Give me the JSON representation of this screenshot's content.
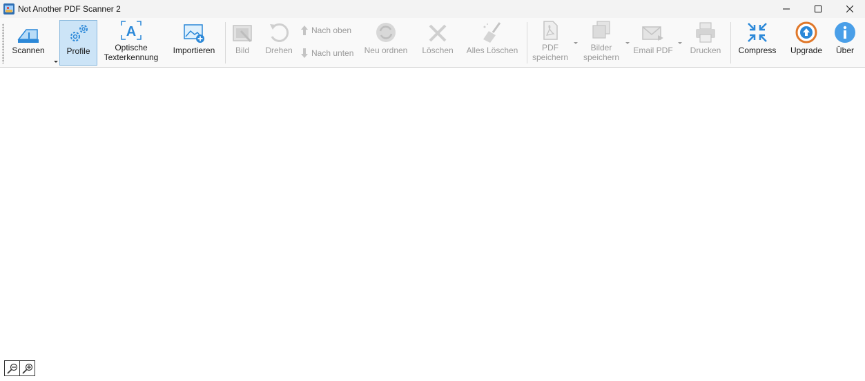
{
  "window": {
    "title": "Not Another PDF Scanner 2",
    "controls": [
      "minimize",
      "maximize",
      "close"
    ]
  },
  "toolbar": {
    "scan": "Scannen",
    "profile": "Profile",
    "ocr": "Optische\nTexterkennung",
    "import": "Importieren",
    "image": "Bild",
    "rotate": "Drehen",
    "move_up": "Nach oben",
    "move_down": "Nach unten",
    "reorder": "Neu ordnen",
    "delete": "Löschen",
    "delete_all": "Alles Löschen",
    "save_pdf": "PDF\nspeichern",
    "save_images": "Bilder\nspeichern",
    "email_pdf": "Email PDF",
    "print": "Drucken",
    "compress": "Compress",
    "upgrade": "Upgrade",
    "about": "Über"
  },
  "colors": {
    "accent": "#2b88d8",
    "active_bg": "#cce4f7",
    "disabled_text": "#9a9a9a",
    "upgrade_orange": "#e0782a"
  }
}
